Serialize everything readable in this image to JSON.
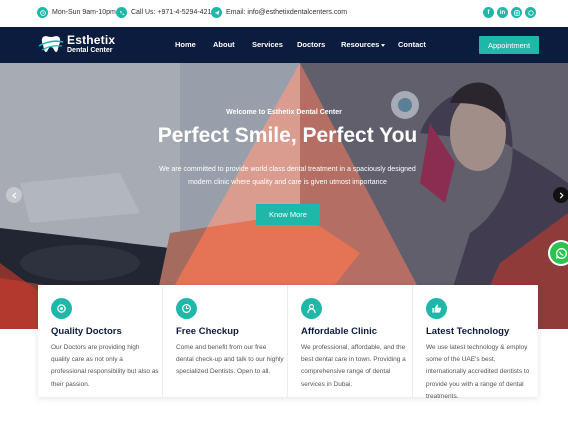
{
  "topbar": {
    "hours": "Mon-Sun 9am-10pm",
    "phone": "Call Us: +971-4-5294-421",
    "email": "Email: info@esthetixdentalcenters.com",
    "social": [
      "f",
      "in",
      "ig",
      "wa"
    ]
  },
  "nav": {
    "brand": "Esthetix",
    "sub": "Dental Center",
    "items": [
      "Home",
      "About",
      "Services",
      "Doctors",
      "Resources",
      "Contact"
    ],
    "appointment": "Appointment"
  },
  "hero": {
    "welcome": "Welcome to Esthetix Dental Center",
    "headline": "Perfect Smile, Perfect You",
    "desc": "We are committed to provide world class dental treatment in a spaciously designed modern clinic where quality and care is given utmost importance",
    "cta": "Know More"
  },
  "features": [
    {
      "icon": "badge-icon",
      "title": "Quality Doctors",
      "text": "Our Doctors are providing high quality care as not only a professional responsibility but also as their passion."
    },
    {
      "icon": "clock-icon",
      "title": "Free Checkup",
      "text": "Come and benefit from our free dental check-up and talk to our highly specialized Dentists. Open to all."
    },
    {
      "icon": "user-icon",
      "title": "Affordable Clinic",
      "text": "We professional, affordable, and the best dental care in town. Providing a comprehensive range of dental services in Dubai."
    },
    {
      "icon": "thumbs-up-icon",
      "title": "Latest Technology",
      "text": "We use latest technology & employ some of the UAE's best, internationally accredited dentists to provide you with a range of dental treatments."
    }
  ],
  "colors": {
    "accent": "#1fb7a8",
    "navy": "#0c1c3e",
    "whatsapp": "#2cc44f"
  }
}
